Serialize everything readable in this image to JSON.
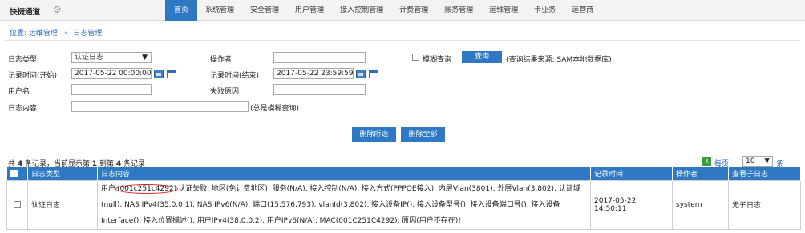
{
  "header": {
    "brand": "快捷通道",
    "nav": [
      "首页",
      "系统管理",
      "安全管理",
      "用户管理",
      "接入控制管理",
      "计费管理",
      "账务管理",
      "运维管理",
      "卡业务",
      "运营商"
    ],
    "active_index": 0
  },
  "breadcrumb": {
    "prefix": "位置:",
    "level1": "运维管理",
    "sep": "›",
    "level2": "日志管理"
  },
  "filters": {
    "log_type_label": "日志类型",
    "log_type_value": "认证日志",
    "operator_label": "操作者",
    "operator_value": "",
    "fuzzy_label": "模糊查询",
    "query_button": "查询",
    "query_note": "(查询结果来源: SAM本地数据库)",
    "start_label": "记录时间(开始)",
    "start_value": "2017-05-22 00:00:00",
    "end_label": "记录时间(结束)",
    "end_value": "2017-05-22 23:59:59",
    "user_label": "用户名",
    "user_value": "",
    "fail_label": "失败原因",
    "fail_value": "",
    "content_label": "日志内容",
    "content_value": "",
    "content_note": "(总是模糊查询)"
  },
  "actions": {
    "delete_selected": "删除所选",
    "delete_all": "删除全部"
  },
  "summary": {
    "p1": "共 ",
    "total": "4",
    "p2": " 条记录，当前显示第 ",
    "from": "1",
    "p3": " 到第 ",
    "to": "4",
    "p4": " 条记录"
  },
  "paging": {
    "per_page_label": "每页",
    "per_page_value": "10",
    "tail": "条"
  },
  "table": {
    "headers": [
      "日志类型",
      "日志内容",
      "记录时间",
      "操作者",
      "查看子日志"
    ],
    "rows": [
      {
        "type": "认证日志",
        "content_pre": "用户",
        "content_mark": "(001c251c4292)",
        "content_post": "认证失败, 地区(免计费地区), 服务(N/A), 接入控制(N/A), 接入方式(PPPOE接入), 内层Vlan(3801), 外层Vlan(3,802), 认证域(null), NAS IPv4(35.0.0.1), NAS IPv6(N/A), 端口(15,576,793), vlanId(3,802), 接入设备IP(), 接入设备型号(), 接入设备端口号(), 接入设备Interface(), 接入位置描述(), 用户IPv4(38.0.0.2), 用户IPv6(N/A), MAC(001C251C4292), 原因(用户不存在)!",
        "time": "2017-05-22 14:50:11",
        "operator": "system",
        "sub": "无子日志"
      }
    ]
  }
}
